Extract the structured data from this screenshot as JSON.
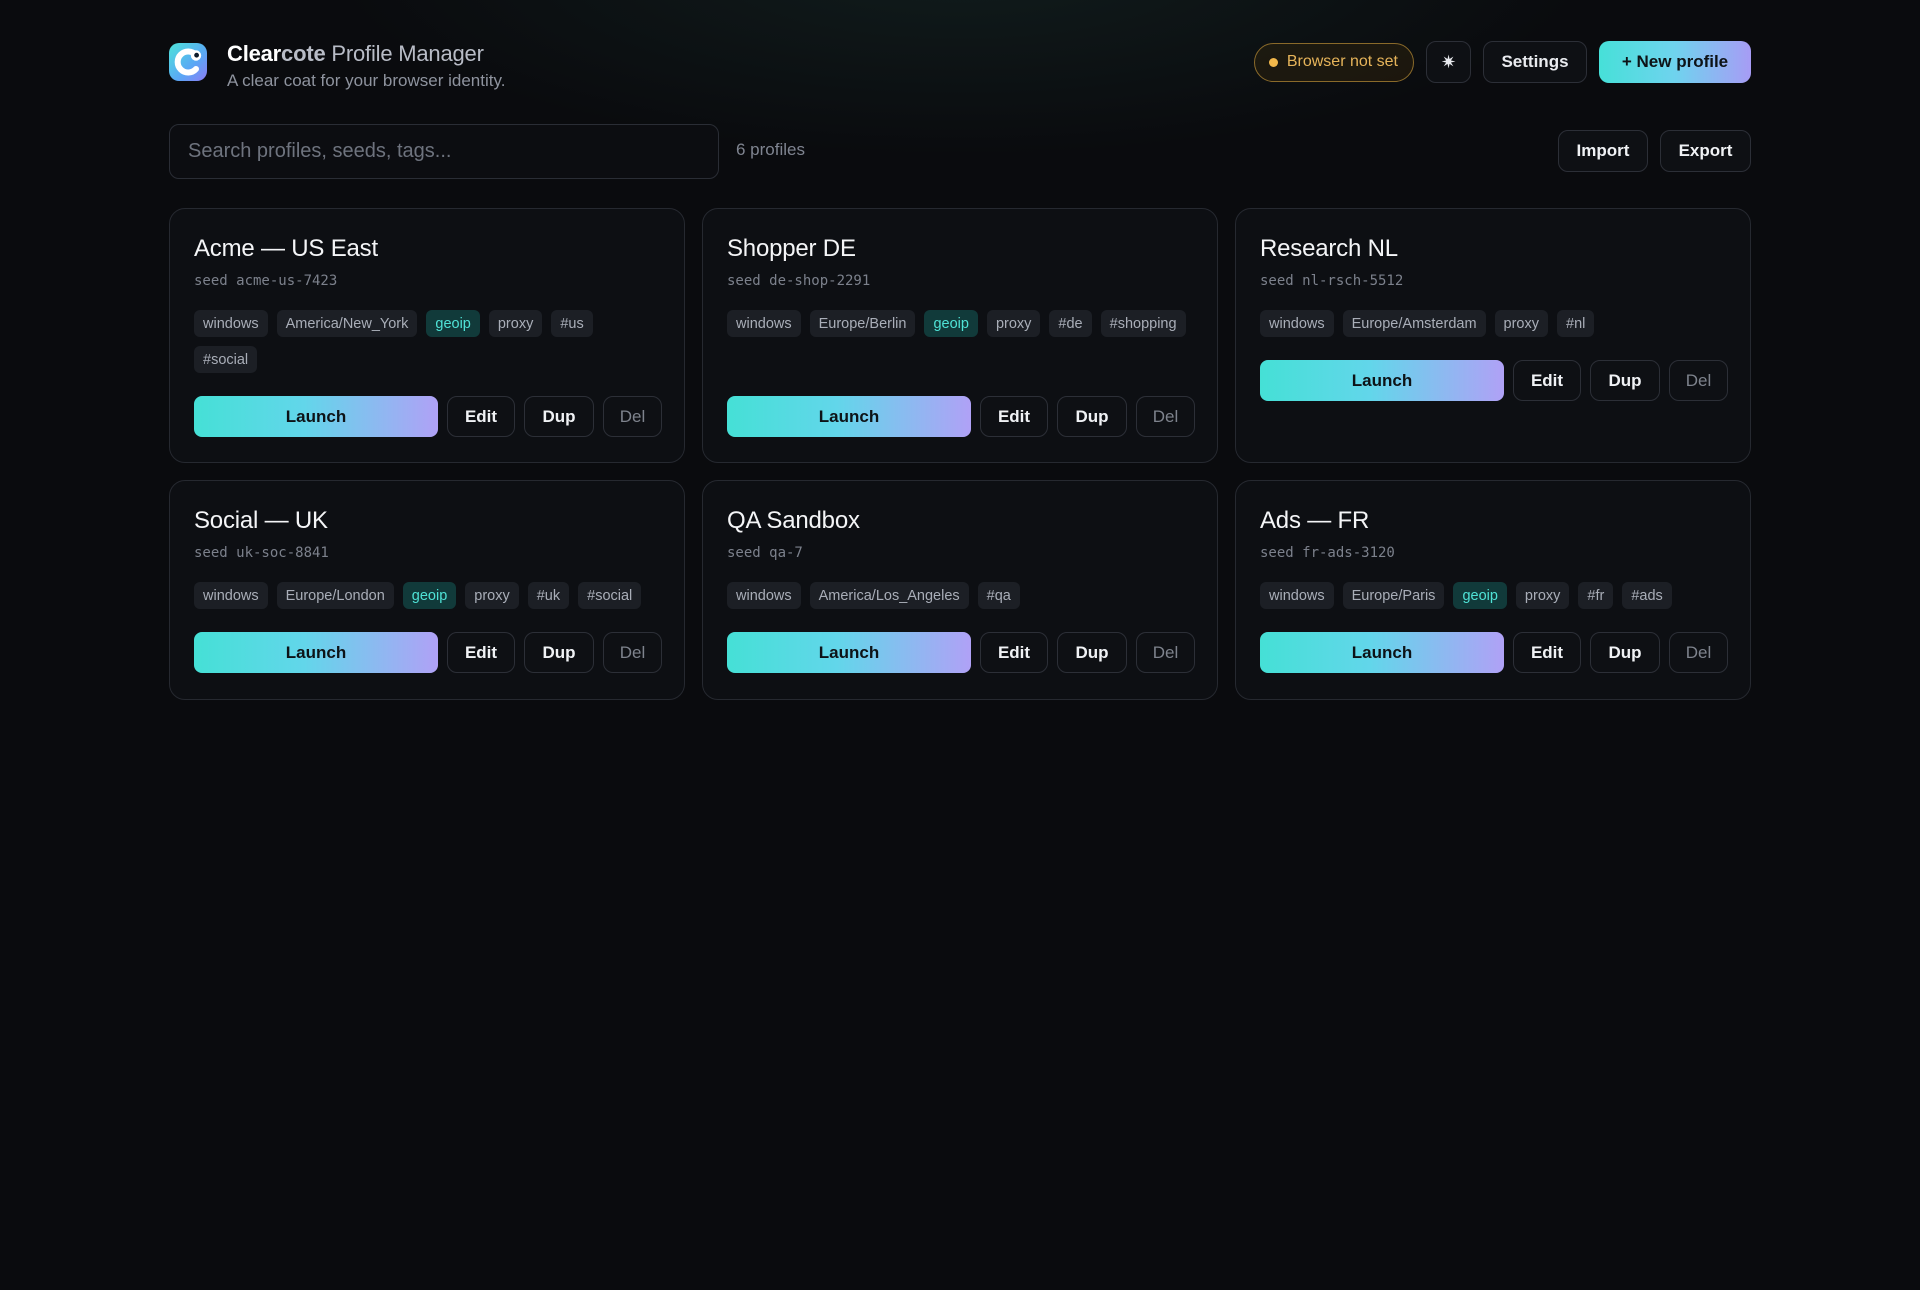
{
  "app": {
    "name_strong": "Clear",
    "name_mid": "cote",
    "name_rest": " Profile Manager",
    "subtitle": "A clear coat for your browser identity.",
    "logo_icon": "clearcote-logo-icon"
  },
  "header": {
    "browser_status": "Browser not set",
    "theme_icon": "✷",
    "settings_label": "Settings",
    "new_profile_label": "+ New profile"
  },
  "toolbar": {
    "search_placeholder": "Search profiles, seeds, tags...",
    "count_label": "6 profiles",
    "import_label": "Import",
    "export_label": "Export"
  },
  "actions": {
    "launch": "Launch",
    "edit": "Edit",
    "dup": "Dup",
    "del": "Del"
  },
  "profiles": [
    {
      "name": "Acme — US East",
      "seed": "seed acme-us-7423",
      "tags": [
        "windows",
        "America/New_York",
        "geoip",
        "proxy",
        "#us",
        "#social"
      ]
    },
    {
      "name": "Shopper DE",
      "seed": "seed de-shop-2291",
      "tags": [
        "windows",
        "Europe/Berlin",
        "geoip",
        "proxy",
        "#de",
        "#shopping"
      ]
    },
    {
      "name": "Research NL",
      "seed": "seed nl-rsch-5512",
      "tags": [
        "windows",
        "Europe/Amsterdam",
        "proxy",
        "#nl"
      ]
    },
    {
      "name": "Social — UK",
      "seed": "seed uk-soc-8841",
      "tags": [
        "windows",
        "Europe/London",
        "geoip",
        "proxy",
        "#uk",
        "#social"
      ]
    },
    {
      "name": "QA Sandbox",
      "seed": "seed qa-7",
      "tags": [
        "windows",
        "America/Los_Angeles",
        "#qa"
      ]
    },
    {
      "name": "Ads — FR",
      "seed": "seed fr-ads-3120",
      "tags": [
        "windows",
        "Europe/Paris",
        "geoip",
        "proxy",
        "#fr",
        "#ads"
      ]
    }
  ],
  "colors": {
    "background": "#0a0b0e",
    "accent_start": "#46e0d8",
    "accent_end": "#a79cf5",
    "warning": "#f2b84b",
    "geoip_tag": "#4fe2d6"
  }
}
